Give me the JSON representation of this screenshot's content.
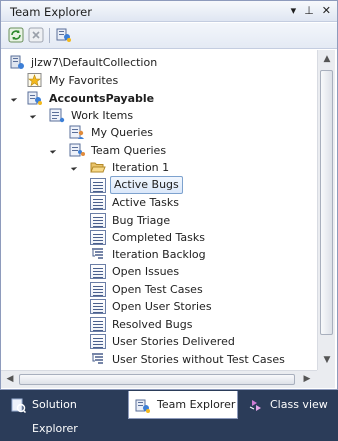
{
  "window": {
    "title": "Team Explorer",
    "pin_glyph": "▾",
    "autohide_glyph": "⊥",
    "close_glyph": "✕"
  },
  "toolbar": {
    "refresh": "refresh-icon",
    "stop": "stop-icon",
    "connect": "connect-to-team-project-icon"
  },
  "tree": [
    {
      "label": "jlzw7\\DefaultCollection",
      "icon": "server-icon",
      "depth": 0,
      "expander": "none"
    },
    {
      "label": "My Favorites",
      "icon": "favorites-star-icon",
      "depth": 1,
      "expander": "none"
    },
    {
      "label": "AccountsPayable",
      "icon": "team-project-icon",
      "depth": 1,
      "expander": "expanded",
      "bold": true
    },
    {
      "label": "Work Items",
      "icon": "work-items-icon",
      "depth": 2,
      "expander": "expanded"
    },
    {
      "label": "My Queries",
      "icon": "my-queries-icon",
      "depth": 3,
      "expander": "none"
    },
    {
      "label": "Team Queries",
      "icon": "team-queries-icon",
      "depth": 3,
      "expander": "expanded"
    },
    {
      "label": "Iteration 1",
      "icon": "folder-open-icon",
      "depth": 4,
      "expander": "expanded"
    },
    {
      "label": "Active Bugs",
      "icon": "query-icon",
      "depth": 5,
      "expander": "none",
      "selected": true
    },
    {
      "label": "Active Tasks",
      "icon": "query-icon",
      "depth": 5,
      "expander": "none"
    },
    {
      "label": "Bug Triage",
      "icon": "query-icon",
      "depth": 5,
      "expander": "none"
    },
    {
      "label": "Completed Tasks",
      "icon": "query-icon",
      "depth": 5,
      "expander": "none"
    },
    {
      "label": "Iteration Backlog",
      "icon": "tree-query-icon",
      "depth": 5,
      "expander": "none"
    },
    {
      "label": "Open Issues",
      "icon": "query-icon",
      "depth": 5,
      "expander": "none"
    },
    {
      "label": "Open Test Cases",
      "icon": "query-icon",
      "depth": 5,
      "expander": "none"
    },
    {
      "label": "Open User Stories",
      "icon": "query-icon",
      "depth": 5,
      "expander": "none"
    },
    {
      "label": "Resolved Bugs",
      "icon": "query-icon",
      "depth": 5,
      "expander": "none"
    },
    {
      "label": "User Stories Delivered",
      "icon": "query-icon",
      "depth": 5,
      "expander": "none"
    },
    {
      "label": "User Stories without Test Cases",
      "icon": "tree-query-icon",
      "depth": 5,
      "expander": "none"
    }
  ],
  "tabs": [
    {
      "label": "Solution Explorer",
      "icon": "solution-explorer-icon",
      "active": false
    },
    {
      "label": "Team Explorer",
      "icon": "team-explorer-icon",
      "active": true
    },
    {
      "label": "Class view",
      "icon": "class-view-icon",
      "active": false
    }
  ],
  "colors": {
    "tab_strip": "#2b3c59",
    "selection_border": "#7da2ce",
    "window_border": "#8e9bbc"
  }
}
